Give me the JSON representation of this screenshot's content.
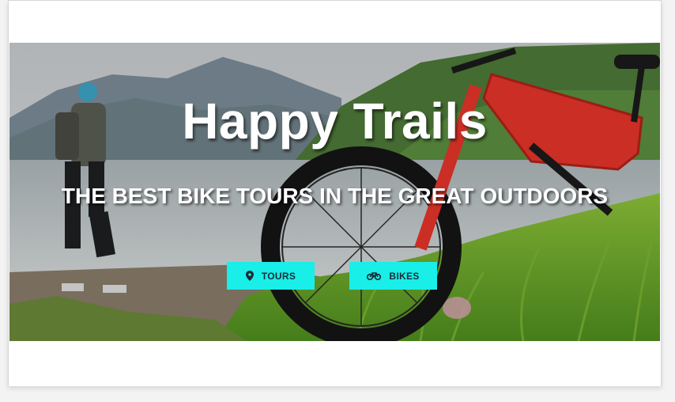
{
  "hero": {
    "title": "Happy Trails",
    "subtitle": "THE BEST BIKE TOURS IN THE GREAT OUTDOORS",
    "buttons": {
      "tours": {
        "label": "TOURS",
        "icon": "map-marker-icon"
      },
      "bikes": {
        "label": "BIKES",
        "icon": "bicycle-icon"
      }
    }
  },
  "colors": {
    "button_bg": "#19eee9",
    "button_text": "#1c2b33",
    "title_text": "#ffffff"
  }
}
